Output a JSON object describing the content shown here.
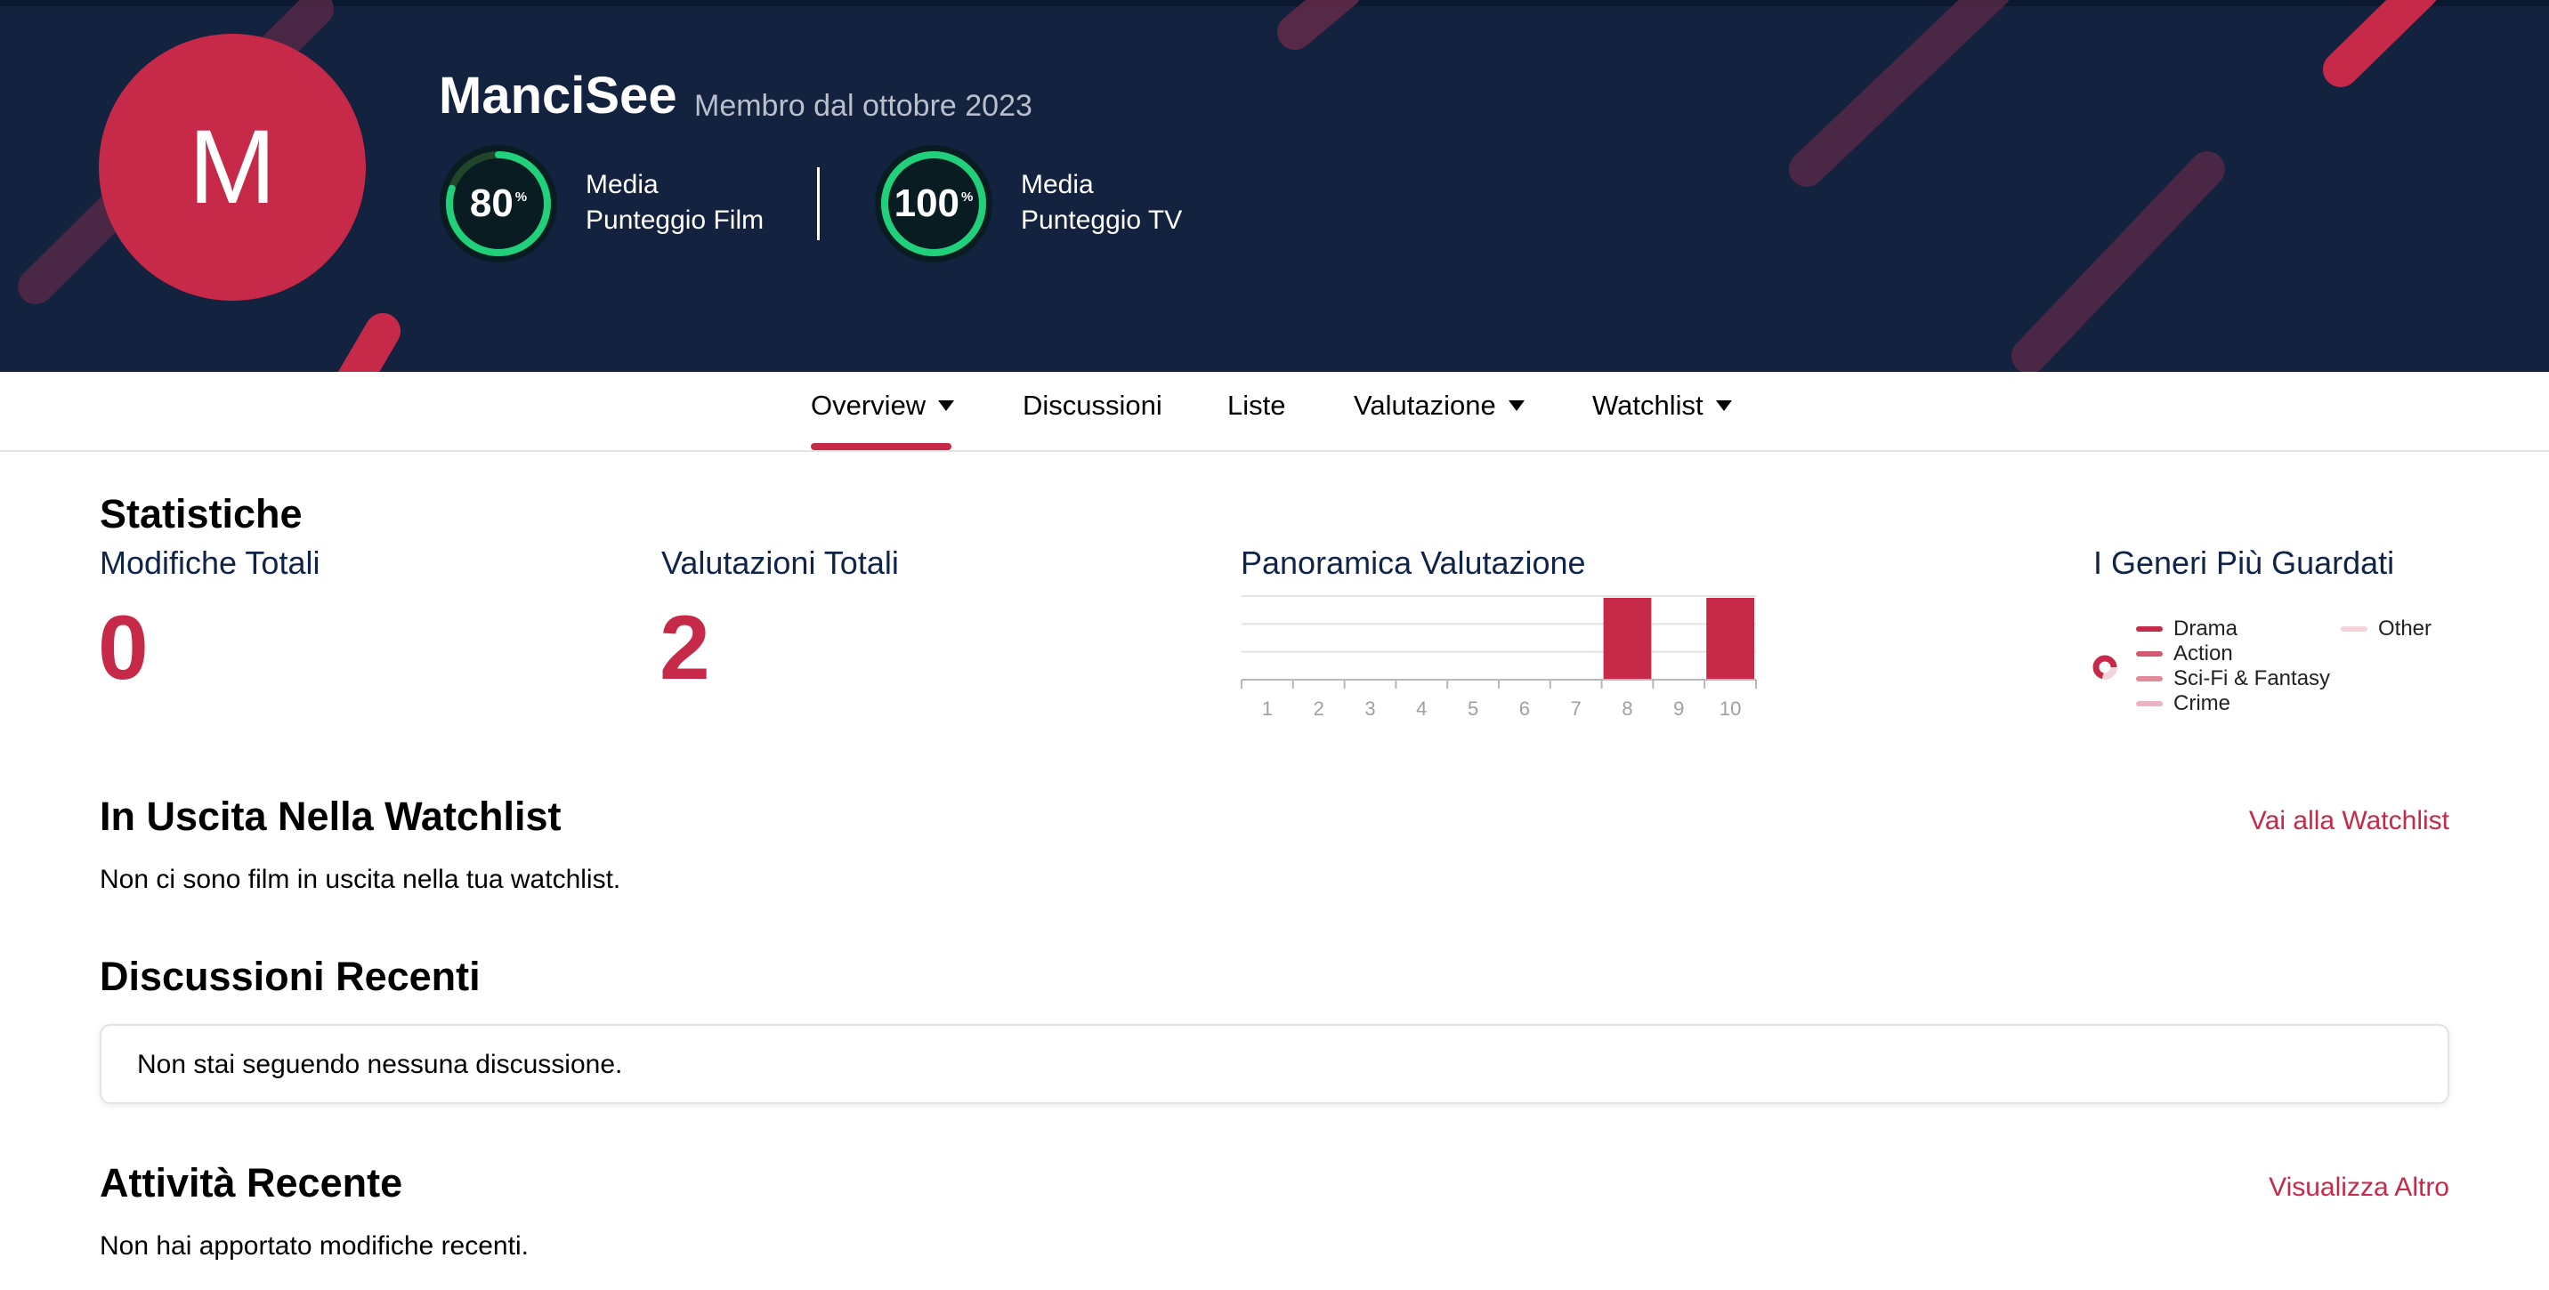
{
  "profile": {
    "avatar_letter": "M",
    "username": "ManciSee",
    "member_since": "Membro dal ottobre 2023",
    "film_score": {
      "value": "80",
      "unit": "%",
      "label_line1": "Media",
      "label_line2": "Punteggio Film",
      "percent": 80
    },
    "tv_score": {
      "value": "100",
      "unit": "%",
      "label_line1": "Media",
      "label_line2": "Punteggio TV",
      "percent": 100
    }
  },
  "nav": {
    "items": [
      {
        "label": "Overview",
        "has_dropdown": true,
        "active": true
      },
      {
        "label": "Discussioni",
        "has_dropdown": false
      },
      {
        "label": "Liste",
        "has_dropdown": false
      },
      {
        "label": "Valutazione",
        "has_dropdown": true
      },
      {
        "label": "Watchlist",
        "has_dropdown": true
      }
    ]
  },
  "stats": {
    "heading": "Statistiche",
    "total_edits_label": "Modifiche Totali",
    "total_edits_value": "0",
    "total_ratings_label": "Valutazioni Totali",
    "total_ratings_value": "2",
    "rating_overview_label": "Panoramica Valutazione",
    "top_genres_label": "I Generi Più Guardati",
    "genres": [
      {
        "name": "Drama",
        "color": "#c72a48"
      },
      {
        "name": "Action",
        "color": "#d45a72"
      },
      {
        "name": "Sci-Fi & Fantasy",
        "color": "#e08a9c"
      },
      {
        "name": "Crime",
        "color": "#ecb3c0"
      },
      {
        "name": "Other",
        "color": "#f5d3db"
      }
    ]
  },
  "chart_data": {
    "type": "bar",
    "categories": [
      "1",
      "2",
      "3",
      "4",
      "5",
      "6",
      "7",
      "8",
      "9",
      "10"
    ],
    "values": [
      0,
      0,
      0,
      0,
      0,
      0,
      0,
      1,
      0,
      1
    ],
    "ylim": [
      0,
      1
    ],
    "grid": true,
    "color": "#c72a48"
  },
  "watchlist": {
    "heading": "In Uscita Nella Watchlist",
    "link": "Vai alla Watchlist",
    "empty_text": "Non ci sono film in uscita nella tua watchlist."
  },
  "discussions": {
    "heading": "Discussioni Recenti",
    "empty_text": "Non stai seguendo nessuna discussione."
  },
  "activity": {
    "heading": "Attività Recente",
    "link": "Visualizza Altro",
    "empty_text": "Non hai apportato modifiche recenti."
  },
  "colors": {
    "header_bg": "#13223f",
    "accent": "#c72a48",
    "score_ring": "#21d07a",
    "score_track": "#204529",
    "stat_title": "#10244a"
  }
}
